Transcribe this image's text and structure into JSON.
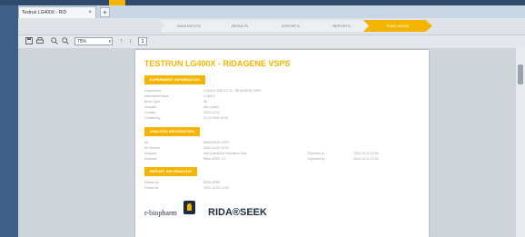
{
  "browser": {
    "tab_title": "Testrun LG400X - RID",
    "close_glyph": "×",
    "new_tab_glyph": "+"
  },
  "stepper": {
    "steps": [
      {
        "label": "DATA INPUTS",
        "active": false
      },
      {
        "label": "RESULTS",
        "active": false
      },
      {
        "label": "EXPORTS",
        "active": false
      },
      {
        "label": "REPORTS",
        "active": false
      },
      {
        "label": "PRINT MODE",
        "active": true
      }
    ]
  },
  "toolbar": {
    "zoom": "75%",
    "page": "1",
    "icons": [
      "save-icon",
      "print-icon",
      "zoom-in-icon",
      "zoom-out-icon",
      "arrow-up-icon",
      "arrow-down-icon"
    ]
  },
  "document": {
    "title": "TESTRUN LG400X - RIDAGENE VSPS",
    "sections": [
      {
        "label": "EXPERIMENT INFORMATION"
      },
      {
        "label": "ANALYSIS INFORMATION"
      },
      {
        "label": "REPORT INFORMATION"
      }
    ],
    "rows1": [
      [
        "Experiment",
        "LG400X 2020-10-22 - RIDAGENE VSPS"
      ],
      [
        "Instrument Name",
        "LC480 II"
      ],
      [
        "Block Type",
        "96"
      ],
      [
        "Analysis",
        "Abs Quant"
      ],
      [
        "Created",
        "2020-10-22"
      ],
      [
        "Created By",
        "22.10.2020 10:00"
      ]
    ],
    "rows2": [
      [
        "Kit",
        "RIDAGENE VSPS"
      ],
      [
        "Kit Version",
        "2020-10-22 10:00"
      ],
      [
        "Analysis",
        "Abs Quant/2nd Derivative Max",
        "Exported at",
        "2020-10-22 12:00"
      ],
      [
        "Software",
        "RIDA SEEK 1.0",
        "Exported by",
        "2020-10-22 12:00"
      ]
    ],
    "rows3": [
      [
        "Printed by",
        "RIDA SEEK"
      ],
      [
        "Printed at",
        "2020-10-22 12:00"
      ]
    ],
    "logos": {
      "left": "r-biopharm",
      "right": "RIDA®SEEK"
    }
  },
  "colors": {
    "accent": "#f5b400",
    "frame": "#3f5f86",
    "navy": "#1f2a44"
  }
}
